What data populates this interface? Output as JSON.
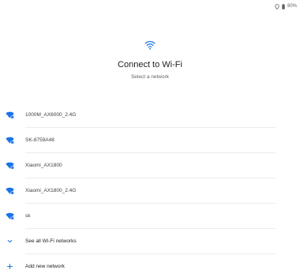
{
  "status_bar": {
    "battery_text": "80%",
    "icons": [
      "location-icon",
      "battery-icon"
    ]
  },
  "header": {
    "icon": "wifi-icon",
    "title": "Connect to Wi-Fi",
    "subtitle": "Select a network"
  },
  "networks": [
    {
      "name": "1000M_AX6000_2.4G",
      "icon": "wifi-secure-icon"
    },
    {
      "name": "SK-8759A48",
      "icon": "wifi-secure-icon"
    },
    {
      "name": "Xiaomi_AX1800",
      "icon": "wifi-secure-icon"
    },
    {
      "name": "Xiaomi_AX1800_2.4G",
      "icon": "wifi-secure-icon"
    },
    {
      "name": "sk",
      "icon": "wifi-secure-icon"
    }
  ],
  "actions": {
    "see_all_label": "See all Wi-Fi networks",
    "add_network_label": "Add new network"
  },
  "colors": {
    "accent": "#1a73e8",
    "text_primary": "#202124",
    "text_secondary": "#5f6368",
    "divider": "#ececec"
  }
}
